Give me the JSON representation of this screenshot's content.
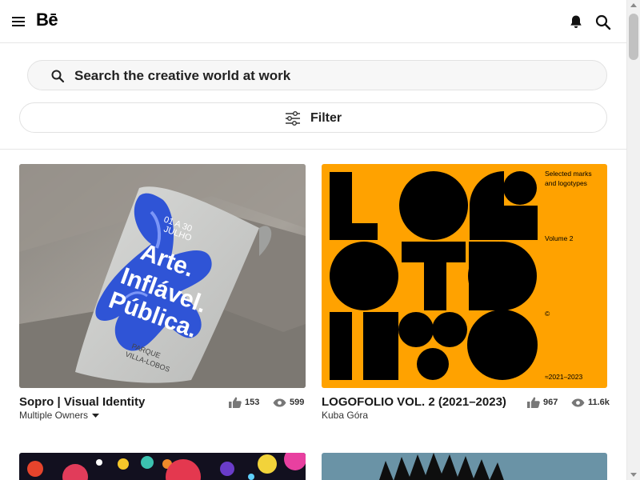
{
  "header": {
    "logo": "Bē",
    "icons": [
      "hamburger-menu-icon",
      "bell-icon",
      "search-icon"
    ]
  },
  "search": {
    "label": "Search the creative world at work"
  },
  "filter": {
    "label": "Filter"
  },
  "projects": [
    {
      "title": "Sopro | Visual Identity",
      "owner": "Multiple Owners",
      "owner_dropdown": true,
      "likes": "153",
      "views": "599",
      "poster_text": {
        "dates": "01 A 30\nJULHO",
        "headline": [
          "Arte.",
          "Inflável.",
          "Pública."
        ],
        "footer": "PARQUE\nVILLA-LOBOS"
      }
    },
    {
      "title": "LOGOFOLIO VOL. 2 (2021–2023)",
      "owner": "Kuba Góra",
      "owner_dropdown": false,
      "likes": "967",
      "views": "11.6k",
      "cover_text": {
        "line1": "Selected marks",
        "line2": "and logotypes",
        "volume": "Volume 2",
        "copyright": "©",
        "years": "≈2021–2023"
      },
      "cover_color": "#FFA200"
    }
  ],
  "colors": {
    "accent_orange": "#FFA200",
    "text_dark": "#191919",
    "border": "#E2E2E2"
  }
}
